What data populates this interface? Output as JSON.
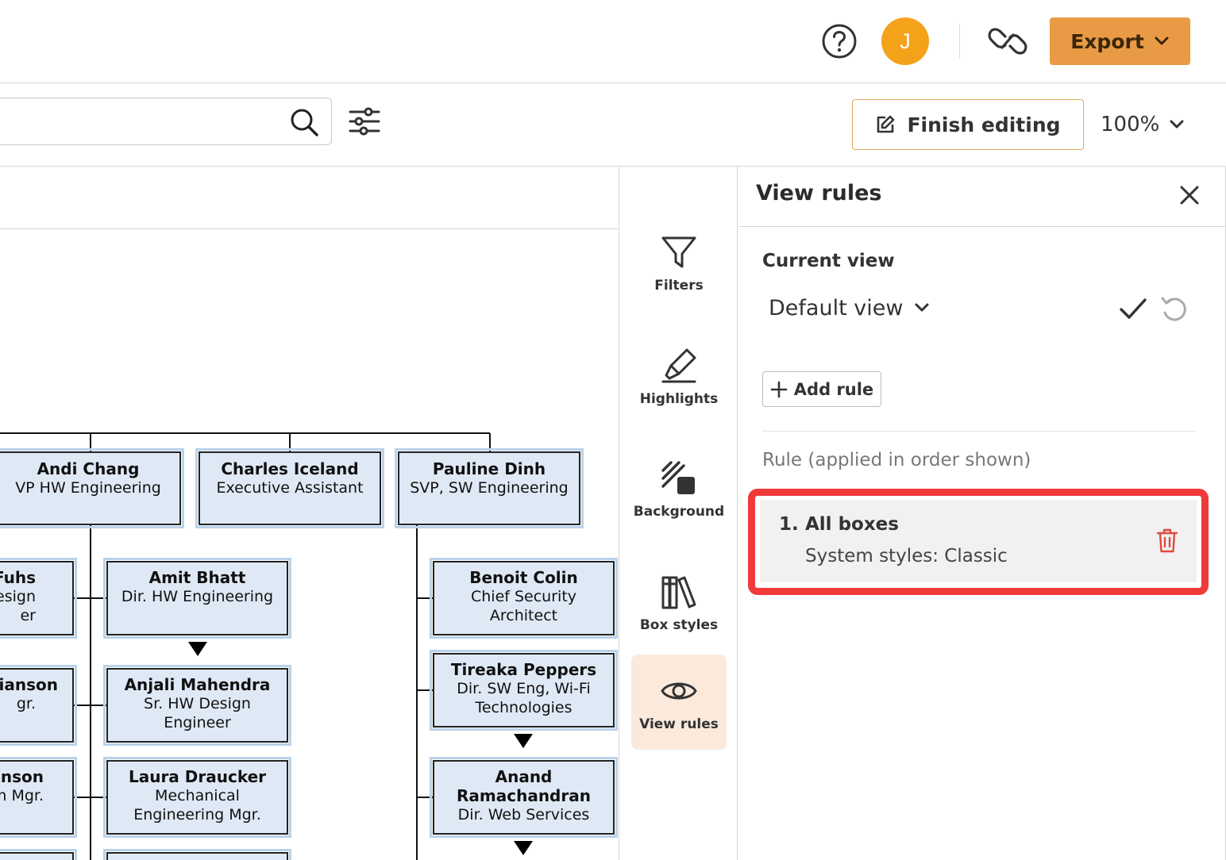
{
  "header": {
    "avatar_initial": "J",
    "export_label": "Export"
  },
  "toolbar": {
    "search_placeholder": "",
    "finish_editing_label": "Finish editing",
    "zoom_level": "100%"
  },
  "chart": {
    "nodes": [
      {
        "name": "Andi Chang",
        "title": "VP HW Engineering"
      },
      {
        "name": "Charles Iceland",
        "title": "Executive Assistant"
      },
      {
        "name": "Pauline Dinh",
        "title": "SVP, SW Engineering"
      },
      {
        "name": "Fuhs",
        "title_line1": "esign",
        "title_line2": "er"
      },
      {
        "name": "Amit Bhatt",
        "title": "Dir. HW Engineering"
      },
      {
        "name": "Benoit Colin",
        "title_line1": "Chief Security",
        "title_line2": "Architect"
      },
      {
        "name": "tianson",
        "title": "gr."
      },
      {
        "name": "Anjali Mahendra",
        "title_line1": "Sr. HW Design",
        "title_line2": "Engineer"
      },
      {
        "name": "Tireaka Peppers",
        "title_line1": "Dir. SW Eng, Wi-Fi",
        "title_line2": "Technologies"
      },
      {
        "name": "nson",
        "title": "m Mgr."
      },
      {
        "name": "Laura Draucker",
        "title_line1": "Mechanical",
        "title_line2": "Engineering Mgr."
      },
      {
        "name_line1": "Anand",
        "name_line2": "Ramachandran",
        "title": "Dir. Web Services"
      }
    ]
  },
  "rail": {
    "items": [
      {
        "label": "Filters",
        "icon": "funnel-icon"
      },
      {
        "label": "Highlights",
        "icon": "highlighter-icon"
      },
      {
        "label": "Background",
        "icon": "background-icon"
      },
      {
        "label": "Box styles",
        "icon": "books-icon"
      },
      {
        "label": "View rules",
        "icon": "eye-icon",
        "active": true
      }
    ]
  },
  "panel": {
    "title": "View rules",
    "current_view_label": "Current view",
    "current_view_value": "Default view",
    "add_rule_label": "Add rule",
    "rule_hint": "Rule (applied in order shown)",
    "rules": [
      {
        "number": "1.",
        "name": "All boxes",
        "description": "System styles: Classic"
      }
    ]
  },
  "colors": {
    "accent": "#e99a45",
    "avatar": "#f5a21b",
    "highlight_outline": "#f03a3a",
    "node_fill": "#dfe9f5",
    "active_rail": "#fbe9dc"
  }
}
